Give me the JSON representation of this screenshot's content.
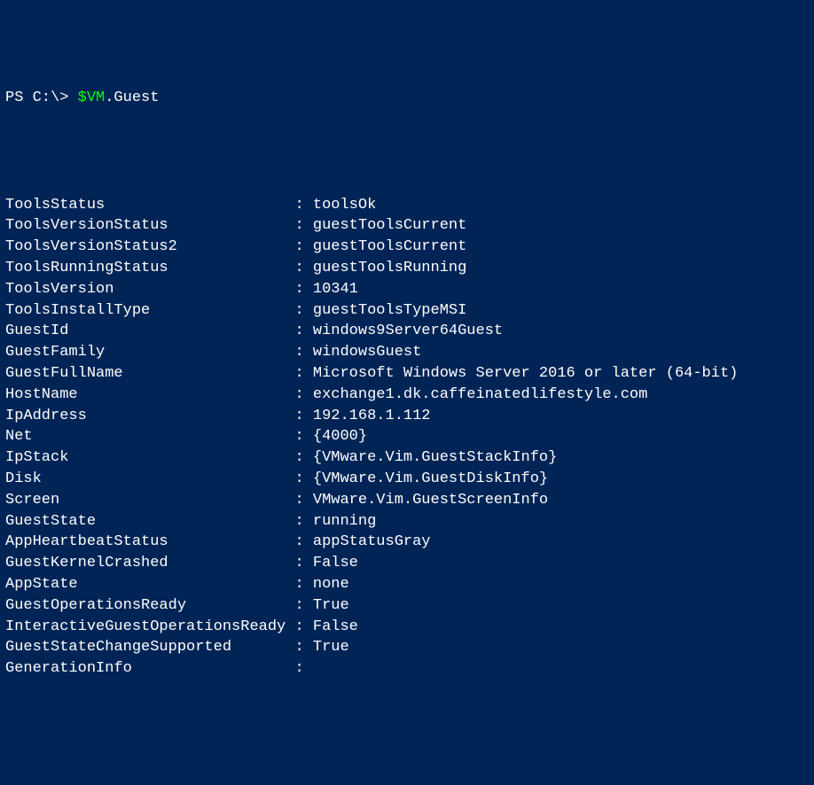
{
  "prompt": {
    "prefix": "PS C:\\> ",
    "variable": "$VM",
    "property": ".Guest"
  },
  "output": [
    {
      "name": "ToolsStatus",
      "value": "toolsOk"
    },
    {
      "name": "ToolsVersionStatus",
      "value": "guestToolsCurrent"
    },
    {
      "name": "ToolsVersionStatus2",
      "value": "guestToolsCurrent"
    },
    {
      "name": "ToolsRunningStatus",
      "value": "guestToolsRunning"
    },
    {
      "name": "ToolsVersion",
      "value": "10341"
    },
    {
      "name": "ToolsInstallType",
      "value": "guestToolsTypeMSI"
    },
    {
      "name": "GuestId",
      "value": "windows9Server64Guest"
    },
    {
      "name": "GuestFamily",
      "value": "windowsGuest"
    },
    {
      "name": "GuestFullName",
      "value": "Microsoft Windows Server 2016 or later (64-bit)"
    },
    {
      "name": "HostName",
      "value": "exchange1.dk.caffeinatedlifestyle.com"
    },
    {
      "name": "IpAddress",
      "value": "192.168.1.112"
    },
    {
      "name": "Net",
      "value": "{4000}"
    },
    {
      "name": "IpStack",
      "value": "{VMware.Vim.GuestStackInfo}"
    },
    {
      "name": "Disk",
      "value": "{VMware.Vim.GuestDiskInfo}"
    },
    {
      "name": "Screen",
      "value": "VMware.Vim.GuestScreenInfo"
    },
    {
      "name": "GuestState",
      "value": "running"
    },
    {
      "name": "AppHeartbeatStatus",
      "value": "appStatusGray"
    },
    {
      "name": "GuestKernelCrashed",
      "value": "False"
    },
    {
      "name": "AppState",
      "value": "none"
    },
    {
      "name": "GuestOperationsReady",
      "value": "True"
    },
    {
      "name": "InteractiveGuestOperationsReady",
      "value": "False"
    },
    {
      "name": "GuestStateChangeSupported",
      "value": "True"
    },
    {
      "name": "GenerationInfo",
      "value": ""
    }
  ],
  "format": {
    "name_width": 31,
    "separator": " : "
  }
}
